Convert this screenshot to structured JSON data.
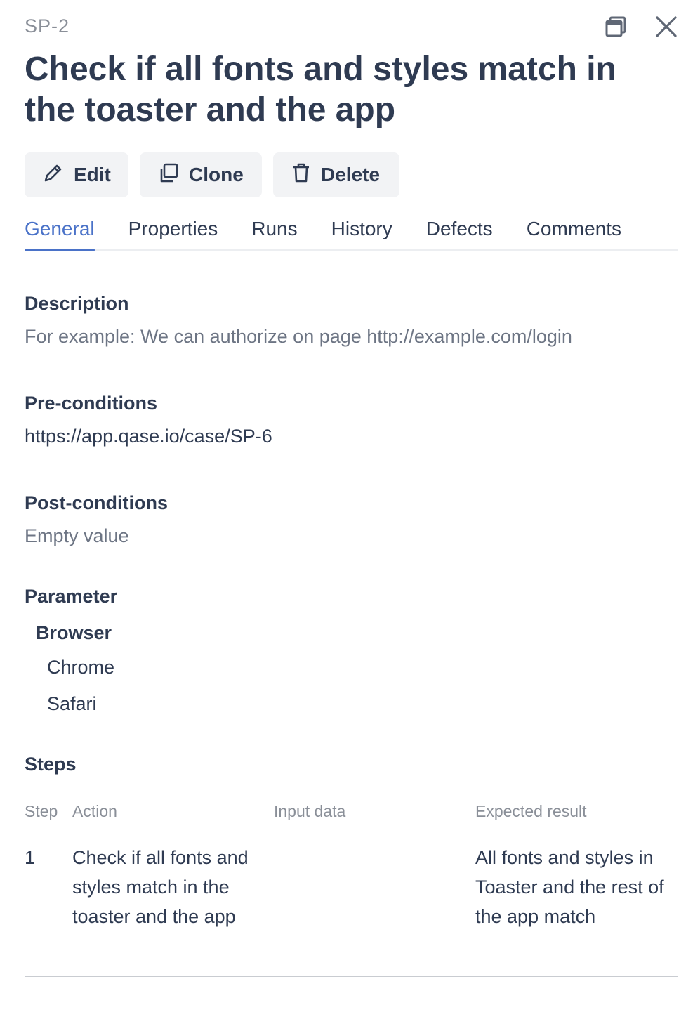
{
  "case": {
    "id": "SP-2",
    "title": "Check if all fonts and styles match in the toaster and the app"
  },
  "icons": {
    "expand": "window-restore-icon",
    "close": "close-icon",
    "edit": "pencil-icon",
    "clone": "copy-icon",
    "delete": "trash-icon"
  },
  "actions": {
    "edit_label": "Edit",
    "clone_label": "Clone",
    "delete_label": "Delete"
  },
  "tabs": [
    {
      "label": "General",
      "active": true
    },
    {
      "label": "Properties",
      "active": false
    },
    {
      "label": "Runs",
      "active": false
    },
    {
      "label": "History",
      "active": false
    },
    {
      "label": "Defects",
      "active": false
    },
    {
      "label": "Comments",
      "active": false
    }
  ],
  "general": {
    "description": {
      "label": "Description",
      "value": "For example: We can authorize on page http://example.com/login"
    },
    "preconditions": {
      "label": "Pre-conditions",
      "value": "https://app.qase.io/case/SP-6"
    },
    "postconditions": {
      "label": "Post-conditions",
      "value": "Empty value"
    },
    "parameter": {
      "label": "Parameter",
      "name": "Browser",
      "values": [
        "Chrome",
        "Safari"
      ]
    },
    "steps": {
      "label": "Steps",
      "columns": {
        "step": "Step",
        "action": "Action",
        "input": "Input data",
        "expected": "Expected result"
      },
      "rows": [
        {
          "step": "1",
          "action": "Check if all fonts and styles match in the toaster and the app",
          "input": "",
          "expected": "All fonts and styles in Toaster and the rest of the app match"
        }
      ]
    }
  },
  "colors": {
    "accent": "#4a72c8",
    "text": "#2f3b52",
    "muted": "#6d7584",
    "button_bg": "#f2f3f5"
  }
}
